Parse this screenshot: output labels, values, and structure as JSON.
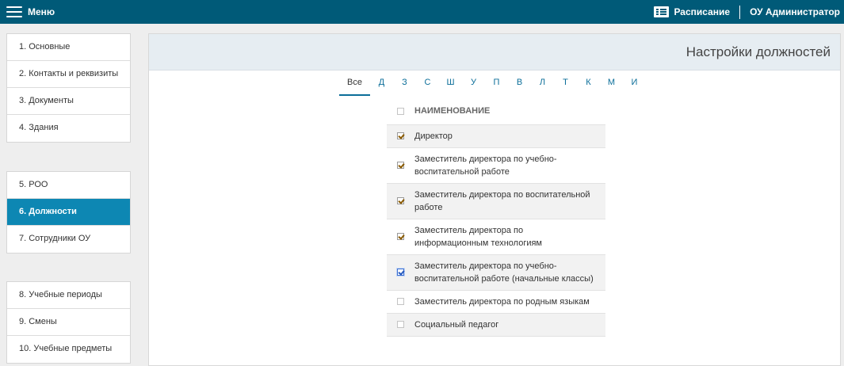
{
  "topbar": {
    "menu_label": "Меню",
    "schedule_label": "Расписание",
    "user_label": "ОУ Администратор"
  },
  "sidebar": {
    "groups": [
      [
        "1. Основные",
        "2. Контакты и реквизиты",
        "3. Документы",
        "4. Здания"
      ],
      [
        "5. РОО",
        "6. Должности",
        "7. Сотрудники ОУ"
      ],
      [
        "8. Учебные периоды",
        "9. Смены",
        "10. Учебные предметы"
      ]
    ],
    "active": "6. Должности"
  },
  "main": {
    "title": "Настройки должностей",
    "letters": [
      "Все",
      "Д",
      "З",
      "С",
      "Ш",
      "У",
      "П",
      "В",
      "Л",
      "Т",
      "К",
      "М",
      "И"
    ],
    "active_letter": "Все",
    "column_header": "НАИМЕНОВАНИЕ",
    "rows": [
      {
        "name": "Директор",
        "checked": true
      },
      {
        "name": "Заместитель директора по учебно-воспитательной работе",
        "checked": true
      },
      {
        "name": "Заместитель директора по воспитательной работе",
        "checked": true
      },
      {
        "name": "Заместитель директора по информационным технологиям",
        "checked": true
      },
      {
        "name": "Заместитель директора по учебно-воспитательной работе (начальные классы)",
        "checked": true,
        "focused": true
      },
      {
        "name": "Заместитель директора по родным языкам",
        "checked": false
      },
      {
        "name": "Социальный педагог",
        "checked": false
      }
    ]
  },
  "colors": {
    "topbar": "#005a78",
    "active_nav": "#0d87b3",
    "link": "#0b6e99"
  }
}
